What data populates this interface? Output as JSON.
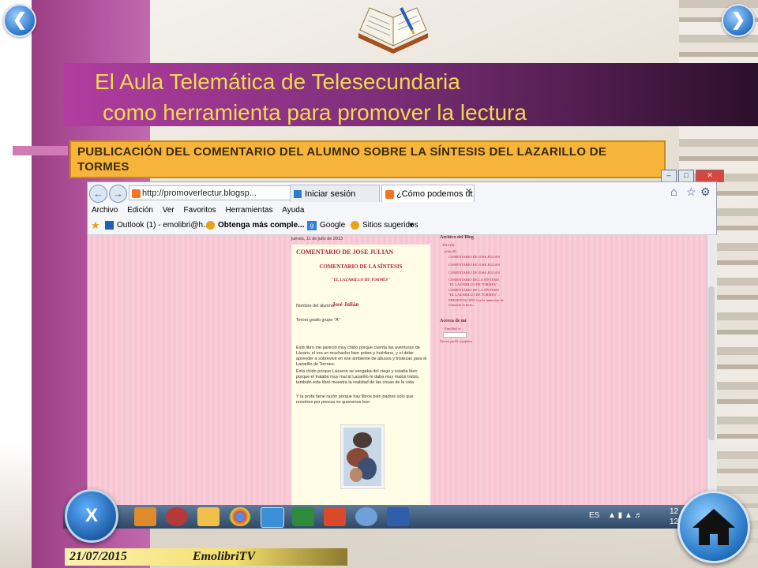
{
  "slide": {
    "title_line1": "El Aula Telemática de Telesecundaria",
    "title_line2": "como herramienta para promover la lectura",
    "subtitle": "PUBLICACIÓN DEL COMENTARIO DEL ALUMNO SOBRE LA SÍNTESIS DEL LAZARILLO DE TORMES",
    "date": "21/07/2015",
    "author": "EmolibriTV",
    "exit_button": "X"
  },
  "browser": {
    "url": "http://promoverlectur.blogsp...",
    "tabs": [
      {
        "label": "Iniciar sesión"
      },
      {
        "label": "¿Cómo podemos ut..."
      }
    ],
    "menu": [
      "Archivo",
      "Edición",
      "Ver",
      "Favoritos",
      "Herramientas",
      "Ayuda"
    ],
    "favorites": [
      {
        "label": "Outlook (1) - emolibri@h..."
      },
      {
        "label": "Obtenga más comple..."
      },
      {
        "label": "Google"
      },
      {
        "label": "Sitios sugeridos"
      }
    ]
  },
  "blog": {
    "date": "jueves, 11 de julio de 2013",
    "post_title": "COMENTARIO DE JOSE JULIAN",
    "heading": "COMENTARIO DE LA SÍNTESIS",
    "book": "\"EL LAZARILLO DE TORMES\"",
    "name_label": "Nombre del alumno:",
    "name": "José Julián",
    "grade": "Tercer grado grupo \"A\"",
    "p1": "Este libro me pareció muy chido porque cuenta las aventuras de Lázaro, el era un muchacho bien pobre y huérfano, y el debe aprender a sobrevivir en ese ambiente de abusos y tristezas para el Lazarillo de Tormes.",
    "p2": "Esta chido porque Lázaron se vengaba del ciego y estaba bien porque el trataba muy mal al Lazarillo le daba muy malos tratos, también este libro muestra la realidad de las cosas de la vida",
    "p3": "Y la profa tiene razón porque hay libros bien padres solo que nosotros por pereza no queremos leer.",
    "archive_title": "Archivo del Blog",
    "archive_year": "2013 (8)",
    "archive_month": "julio (8)",
    "archive_items": [
      "COMENTARIO DE JOSE JULIAN",
      "COMENTARIO DE JOSE JULIAN",
      "COMENTARIO DE JOSE JULIAN",
      "COMENTARIO DE LA SÍNTESIS \"EL LAZARILLO DE TORMES\"...",
      "COMENTARIO DE LA SÍNTESIS \"EL LAZARILLO DE TORMES\"...",
      "PRESENTACIÓN Con la intención de fomentar la lectu..."
    ],
    "about_title": "Acerca de mí",
    "about_name": "Emolibri tv",
    "profile_link": "Ver mi perfil completo"
  },
  "taskbar": {
    "lang": "ES",
    "time": "12",
    "date": "12"
  },
  "colors": {
    "title_text": "#f2d94f",
    "subtitle_bg": "#f6b53a",
    "blog_pink": "#f7c6d2",
    "post_bg": "#fffde5",
    "accent_red": "#b3213f"
  },
  "icons": [
    "back-arrow-icon",
    "forward-arrow-icon",
    "open-book-icon",
    "home-icon",
    "exit-x-icon"
  ]
}
